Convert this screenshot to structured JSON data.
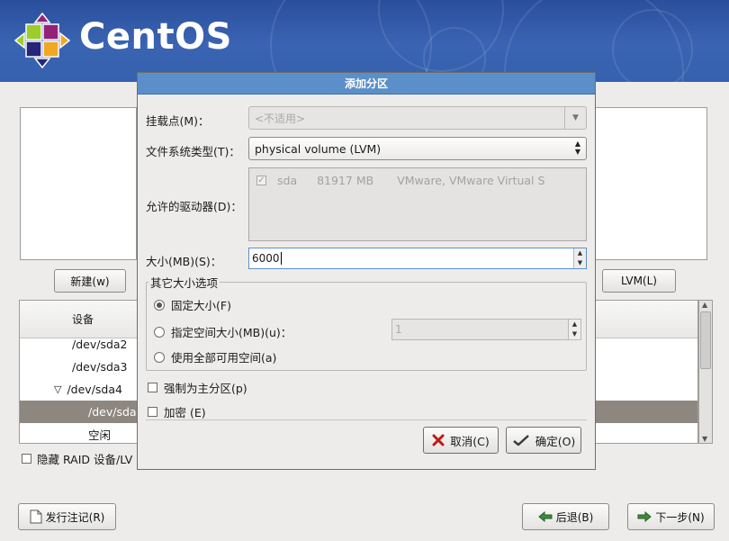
{
  "brand": {
    "logo_text": "CentOS"
  },
  "main": {
    "new_label": "新建(w)",
    "lvm_label": "LVM(L)",
    "tree": {
      "header": "设备",
      "rows": [
        "/dev/sda2",
        "/dev/sda3",
        "/dev/sda4",
        "/dev/sda",
        "空闲"
      ],
      "expand_glyph": "▽"
    },
    "hide_raid_label": "隐藏 RAID 设备/LV"
  },
  "dialog": {
    "title": "添加分区",
    "mount_label": "挂载点(M)：",
    "mount_value": "<不适用>",
    "fstype_label": "文件系统类型(T)：",
    "fstype_value": "physical volume (LVM)",
    "drives_label": "允许的驱动器(D)：",
    "drive": {
      "name": "sda",
      "size": "81917 MB",
      "model": "VMware, VMware Virtual S",
      "checked": true
    },
    "size_label": "大小(MB)(S)：",
    "size_value": "6000",
    "options_legend": "其它大小选项",
    "opt_fixed": "固定大小(F)",
    "opt_max": "指定空间大小(MB)(u)：",
    "opt_max_value": "1",
    "opt_fill": "使用全部可用空间(a)",
    "force_primary": "强制为主分区(p)",
    "encrypt": "加密 (E)",
    "cancel_label": "取消(C)",
    "ok_label": "确定(O)"
  },
  "footer": {
    "release_notes": "发行注记(R)",
    "back": "后退(B)",
    "next": "下一步(N)"
  },
  "colors": {
    "banner": "#3a64b3",
    "title_bar": "#5b8fc9",
    "selection": "#8e8780"
  },
  "icons": [
    "centos-logo-icon",
    "cancel-x-icon",
    "ok-check-icon",
    "document-icon",
    "back-arrow-icon",
    "next-arrow-icon",
    "chevron-down-icon"
  ]
}
